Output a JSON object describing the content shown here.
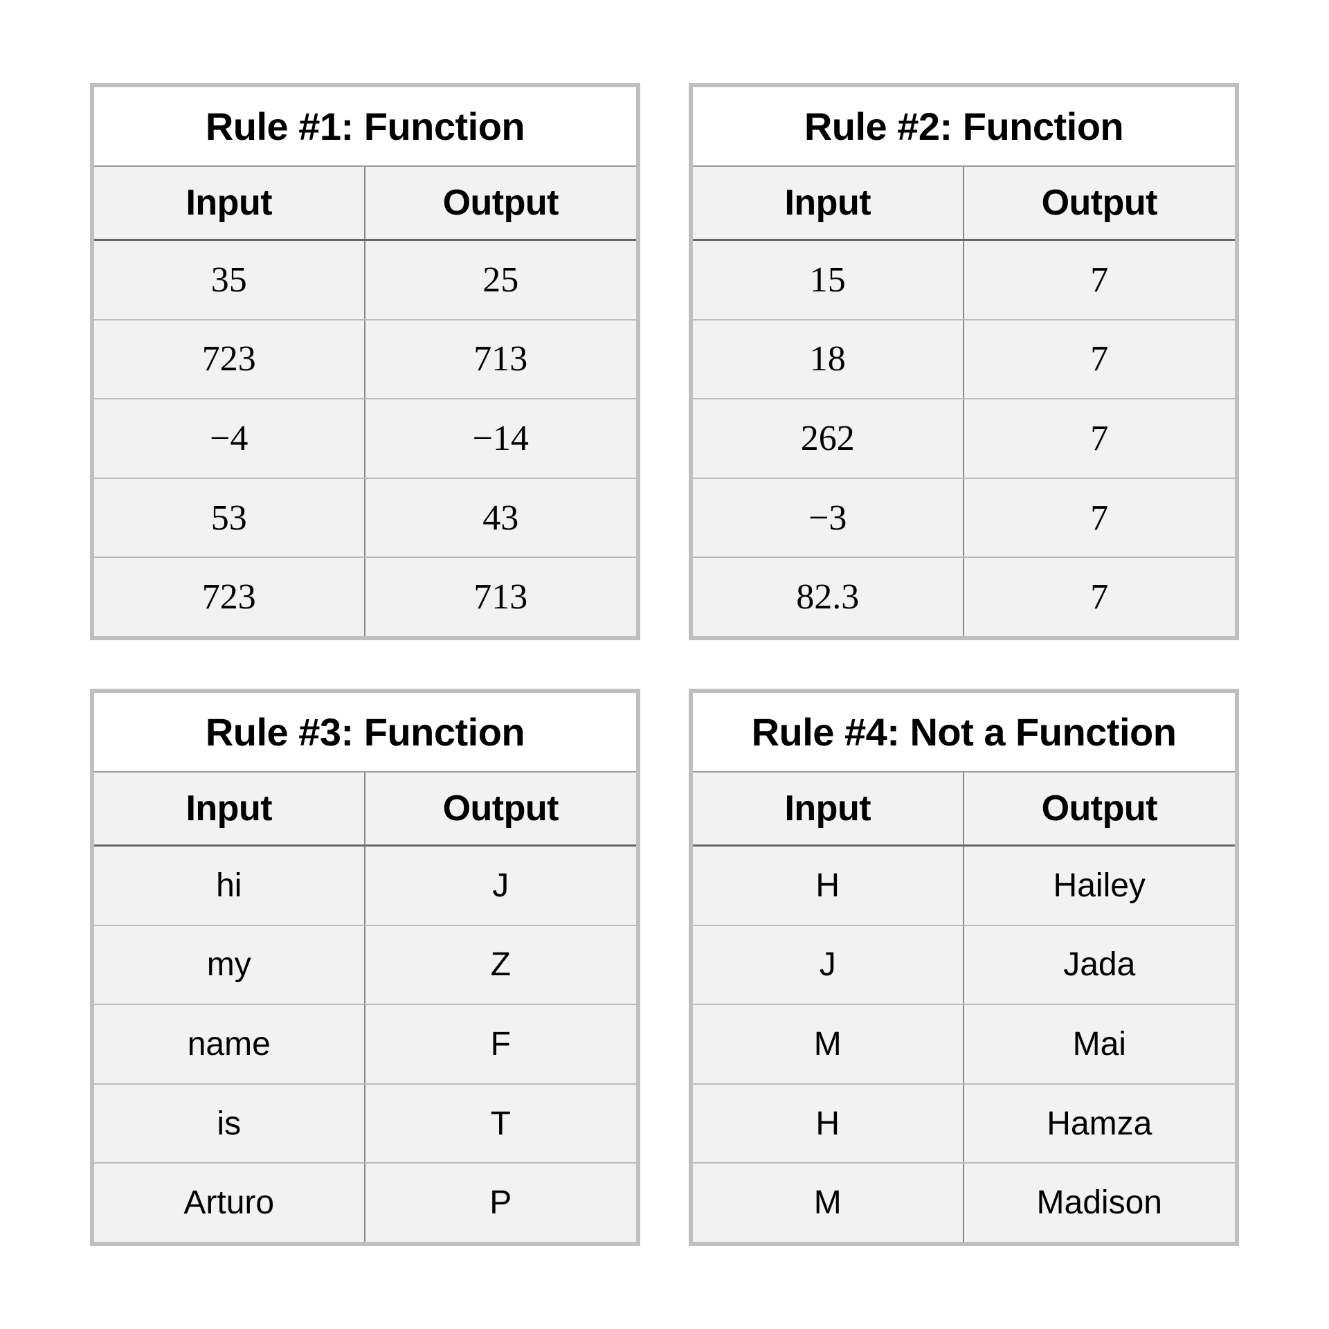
{
  "tables": [
    {
      "title": "Rule #1: Function",
      "headers": {
        "input": "Input",
        "output": "Output"
      },
      "serif": true,
      "rows": [
        {
          "in": "35",
          "out": "25"
        },
        {
          "in": "723",
          "out": "713"
        },
        {
          "in": "−4",
          "out": "−14"
        },
        {
          "in": "53",
          "out": "43"
        },
        {
          "in": "723",
          "out": "713"
        }
      ]
    },
    {
      "title": "Rule #2: Function",
      "headers": {
        "input": "Input",
        "output": "Output"
      },
      "serif": true,
      "rows": [
        {
          "in": "15",
          "out": "7"
        },
        {
          "in": "18",
          "out": "7"
        },
        {
          "in": "262",
          "out": "7"
        },
        {
          "in": "−3",
          "out": "7"
        },
        {
          "in": "82.3",
          "out": "7"
        }
      ]
    },
    {
      "title": "Rule #3: Function",
      "headers": {
        "input": "Input",
        "output": "Output"
      },
      "serif": false,
      "rows": [
        {
          "in": "hi",
          "out": "J"
        },
        {
          "in": "my",
          "out": "Z"
        },
        {
          "in": "name",
          "out": "F"
        },
        {
          "in": "is",
          "out": "T"
        },
        {
          "in": "Arturo",
          "out": "P"
        }
      ]
    },
    {
      "title": "Rule #4: Not a Function",
      "headers": {
        "input": "Input",
        "output": "Output"
      },
      "serif": false,
      "rows": [
        {
          "in": "H",
          "out": "Hailey"
        },
        {
          "in": "J",
          "out": "Jada"
        },
        {
          "in": "M",
          "out": "Mai"
        },
        {
          "in": "H",
          "out": "Hamza"
        },
        {
          "in": "M",
          "out": "Madison"
        }
      ]
    }
  ]
}
